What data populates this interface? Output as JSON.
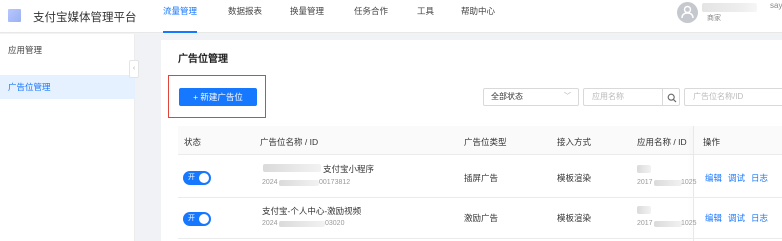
{
  "header": {
    "app_title": "支付宝媒体管理平台",
    "nav": [
      {
        "label": "流量管理",
        "active": true
      },
      {
        "label": "数据报表",
        "active": false
      },
      {
        "label": "换量管理",
        "active": false
      },
      {
        "label": "任务合作",
        "active": false
      },
      {
        "label": "工具",
        "active": false
      },
      {
        "label": "帮助中心",
        "active": false
      }
    ],
    "user_role": "商家",
    "user_tail": "say"
  },
  "sidebar": {
    "items": [
      {
        "label": "应用管理",
        "active": false
      },
      {
        "label": "广告位管理",
        "active": true
      }
    ],
    "collapse_glyph": "‹"
  },
  "main": {
    "title": "广告位管理",
    "new_button_label": "+ 新建广告位",
    "filters": {
      "status_select_value": "全部状态",
      "app_search_placeholder": "应用名称",
      "ad_search_placeholder": "广告位名称/ID"
    },
    "table": {
      "columns": [
        "状态",
        "广告位名称 / ID",
        "广告位类型",
        "接入方式",
        "应用名称 / ID",
        "操作"
      ],
      "rows": [
        {
          "status_label": "开",
          "name": "支付宝小程序",
          "id_prefix": "2024",
          "id_suffix": "00173812",
          "type": "插屏广告",
          "access": "模板渲染",
          "app_id_prefix": "2017",
          "app_id_suffix": "1025",
          "actions": [
            "编辑",
            "调试",
            "日志"
          ]
        },
        {
          "status_label": "开",
          "name": "支付宝-个人中心-激励视频",
          "id_prefix": "2024",
          "id_suffix": "03020",
          "type": "激励广告",
          "access": "模板渲染",
          "app_id_prefix": "2017",
          "app_id_suffix": "1025",
          "actions": [
            "编辑",
            "调试",
            "日志"
          ]
        }
      ]
    }
  },
  "colors": {
    "accent": "#1677ff",
    "highlight_border": "#e0443b",
    "toggle_on": "#1677ff"
  },
  "icons": {
    "avatar": "user-avatar-icon",
    "search": "search-icon",
    "chevron": "chevron-down-icon"
  }
}
